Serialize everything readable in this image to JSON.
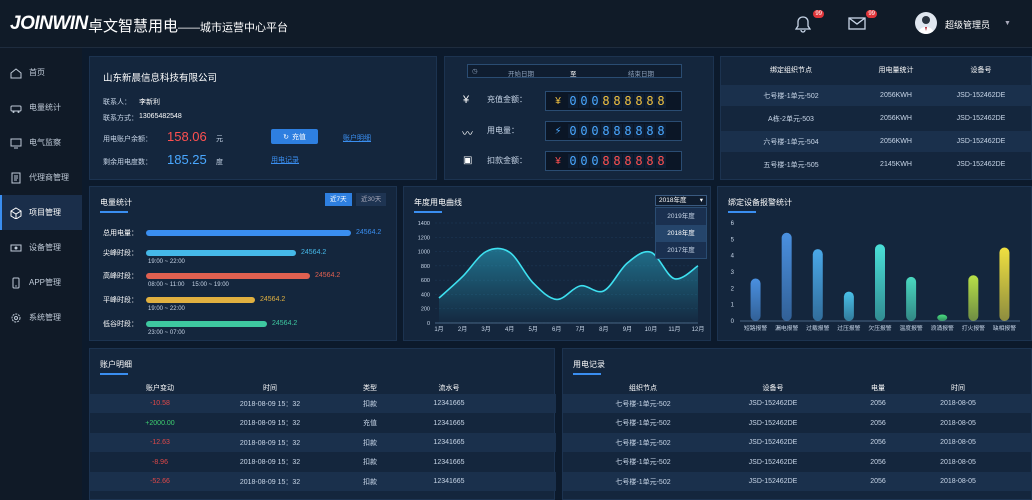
{
  "header": {
    "logo": "JOINWIN",
    "title": "卓文智慧用电",
    "subtitle": "——城市运营中心平台",
    "bell_badge": "99",
    "mail_badge": "99",
    "user": "超级管理员"
  },
  "sidebar": {
    "items": [
      {
        "label": "首页",
        "icon": "home-icon"
      },
      {
        "label": "电量统计",
        "icon": "car-icon"
      },
      {
        "label": "电气监察",
        "icon": "monitor-icon"
      },
      {
        "label": "代理商管理",
        "icon": "document-icon"
      },
      {
        "label": "项目管理",
        "icon": "cube-icon",
        "active": true
      },
      {
        "label": "设备管理",
        "icon": "device-icon"
      },
      {
        "label": "APP管理",
        "icon": "phone-icon"
      },
      {
        "label": "系统管理",
        "icon": "gear-icon"
      }
    ]
  },
  "company": {
    "name": "山东新晨信息科技有限公司",
    "contact_label": "联系人：",
    "contact": "李新利",
    "phone_label": "联系方式：",
    "phone": "13065482548",
    "balance_label": "用电账户余额：",
    "balance": "158.06",
    "balance_unit": "元",
    "recharge": "充值",
    "account_detail": "账户明细",
    "remain_label": "剩余用电度数：",
    "remain": "185.25",
    "remain_unit": "度",
    "usage_record": "用电记录"
  },
  "counters": {
    "start_date": "开始日期",
    "to": "至",
    "end_date": "结束日期",
    "recharge_label": "充值金额：",
    "recharge_digits": [
      "0",
      "0",
      "0",
      "8",
      "8",
      "8",
      "8",
      "8",
      "8"
    ],
    "usage_label": "用电量：",
    "usage_digits": [
      "0",
      "0",
      "0",
      "8",
      "8",
      "8",
      "8",
      "8",
      "8"
    ],
    "deduct_label": "扣款金额：",
    "deduct_digits": [
      "0",
      "0",
      "0",
      "8",
      "8",
      "8",
      "8",
      "8",
      "8"
    ]
  },
  "nodes_table": {
    "headers": [
      "绑定组织节点",
      "用电量统计",
      "设备号"
    ],
    "rows": [
      [
        "七号楼-1单元-502",
        "2056KWH",
        "JSD-152462DE"
      ],
      [
        "A栋-2单元-503",
        "2056KWH",
        "JSD-152462DE"
      ],
      [
        "六号楼-1单元-504",
        "2056KWH",
        "JSD-152462DE"
      ],
      [
        "五号楼-1单元-505",
        "2145KWH",
        "JSD-152462DE"
      ]
    ]
  },
  "power_stats": {
    "title": "电量统计",
    "tab1": "近7天",
    "tab2": "近30天",
    "items": [
      {
        "label": "总用电量：",
        "value": "24564.2",
        "fraction": 1.0,
        "color": "#3a8ef0",
        "times": []
      },
      {
        "label": "尖峰时段：",
        "value": "24564.2",
        "fraction": 0.73,
        "color": "#45b8e8",
        "times": [
          "19:00 ~ 22:00"
        ]
      },
      {
        "label": "高峰时段：",
        "value": "24564.2",
        "fraction": 0.8,
        "color": "#e06050",
        "times": [
          "08:00 ~ 11:00",
          "15:00 ~ 19:00"
        ]
      },
      {
        "label": "平峰时段：",
        "value": "24564.2",
        "fraction": 0.53,
        "color": "#e0b040",
        "times": [
          "19:00 ~ 22:00"
        ]
      },
      {
        "label": "低谷时段：",
        "value": "24564.2",
        "fraction": 0.59,
        "color": "#3ec8a0",
        "times": [
          "23:00 ~ 07:00"
        ]
      }
    ]
  },
  "chart_data": [
    {
      "type": "area",
      "title": "年度用电曲线",
      "x": [
        "1月",
        "2月",
        "3月",
        "4月",
        "5月",
        "6月",
        "7月",
        "8月",
        "9月",
        "10月",
        "11月",
        "12月"
      ],
      "y_ticks": [
        "0",
        "200",
        "400",
        "600",
        "800",
        "1000",
        "1200",
        "1400"
      ],
      "ylim": [
        0,
        1400
      ],
      "values": [
        350,
        650,
        1000,
        990,
        560,
        330,
        520,
        450,
        840,
        990,
        620,
        800
      ],
      "select": "2018年度",
      "options": [
        "2019年度",
        "2018年度",
        "2017年度"
      ]
    },
    {
      "type": "bar",
      "title": "绑定设备报警统计",
      "categories": [
        "短路报警",
        "漏电报警",
        "过载报警",
        "过压报警",
        "欠压报警",
        "温度报警",
        "浪涌报警",
        "打火报警",
        "缺相报警"
      ],
      "values": [
        2.6,
        5.4,
        4.4,
        1.8,
        4.7,
        2.7,
        0.4,
        2.8,
        4.5
      ],
      "y_ticks": [
        "0",
        "1",
        "2",
        "3",
        "4",
        "5",
        "6"
      ],
      "ylim": [
        0,
        6
      ],
      "colors": [
        "#4a90e0",
        "#4a90e0",
        "#4aa8e8",
        "#4ac0e8",
        "#4ae0d8",
        "#4ad8c0",
        "#4ae080",
        "#b8e048",
        "#f0e040"
      ]
    }
  ],
  "accounts": {
    "title": "账户明细",
    "headers": [
      "账户变动",
      "时间",
      "类型",
      "流水号"
    ],
    "rows": [
      {
        "change": "-10.58",
        "color": "#e04848",
        "time": "2018-08-09  15：32",
        "type": "扣款",
        "sn": "12341665"
      },
      {
        "change": "+2000.00",
        "color": "#3ed070",
        "time": "2018-08-09  15：32",
        "type": "充值",
        "sn": "12341665"
      },
      {
        "change": "-12.63",
        "color": "#e04848",
        "time": "2018-08-09  15：32",
        "type": "扣款",
        "sn": "12341665"
      },
      {
        "change": "-8.96",
        "color": "#e04848",
        "time": "2018-08-09  15：32",
        "type": "扣款",
        "sn": "12341665"
      },
      {
        "change": "-52.66",
        "color": "#e04848",
        "time": "2018-08-09  15：32",
        "type": "扣款",
        "sn": "12341665"
      }
    ]
  },
  "usage": {
    "title": "用电记录",
    "headers": [
      "组织节点",
      "设备号",
      "电量",
      "时间"
    ],
    "rows": [
      [
        "七号楼-1单元-502",
        "JSD-152462DE",
        "2056",
        "2018-08-05"
      ],
      [
        "七号楼-1单元-502",
        "JSD-152462DE",
        "2056",
        "2018-08-05"
      ],
      [
        "七号楼-1单元-502",
        "JSD-152462DE",
        "2056",
        "2018-08-05"
      ],
      [
        "七号楼-1单元-502",
        "JSD-152462DE",
        "2056",
        "2018-08-05"
      ],
      [
        "七号楼-1单元-502",
        "JSD-152462DE",
        "2056",
        "2018-08-05"
      ]
    ]
  }
}
